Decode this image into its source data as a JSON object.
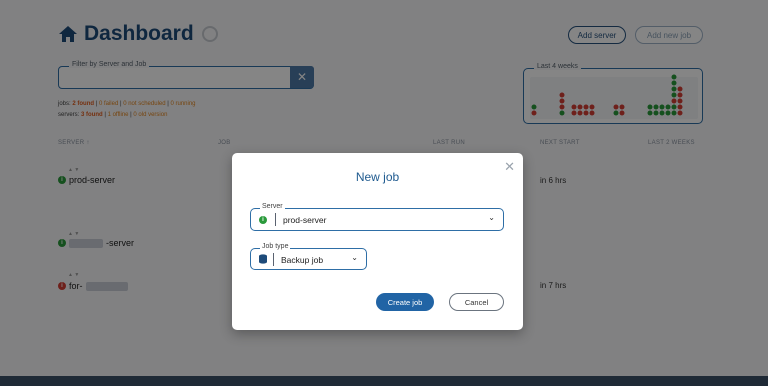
{
  "header": {
    "title": "Dashboard",
    "add_server": "Add server",
    "add_new_job": "Add new job"
  },
  "filter": {
    "label": "Filter by Server and Job"
  },
  "stats": {
    "jobs_label": "jobs:",
    "jobs_found": "2 found",
    "jobs_failed": "0 failed",
    "jobs_not_scheduled": "0 not scheduled",
    "jobs_running": "0 running",
    "servers_label": "servers:",
    "servers_found": "3 found",
    "servers_offline": "1 offline",
    "servers_old_version": "0 old version"
  },
  "last_4_weeks": {
    "label": "Last 4 weeks"
  },
  "table": {
    "columns": [
      "SERVER ↑",
      "JOB",
      "LAST RUN",
      "NEXT START",
      "LAST 2 WEEKS"
    ],
    "rows": [
      {
        "server": "prod-server",
        "next_start": "in 6 hrs"
      },
      {
        "server": "-server",
        "next_start": ""
      },
      {
        "server": "for-",
        "next_start": "in 7 hrs"
      }
    ]
  },
  "modal": {
    "title": "New job",
    "server_label": "Server",
    "server_value": "prod-server",
    "job_type_label": "Job type",
    "job_type_value": "Backup job",
    "create_button": "Create job",
    "cancel_button": "Cancel"
  },
  "colors": {
    "accent": "#2164a5",
    "ok": "#2a9a3b",
    "fail": "#d33f35",
    "warn": "#e3851e"
  }
}
